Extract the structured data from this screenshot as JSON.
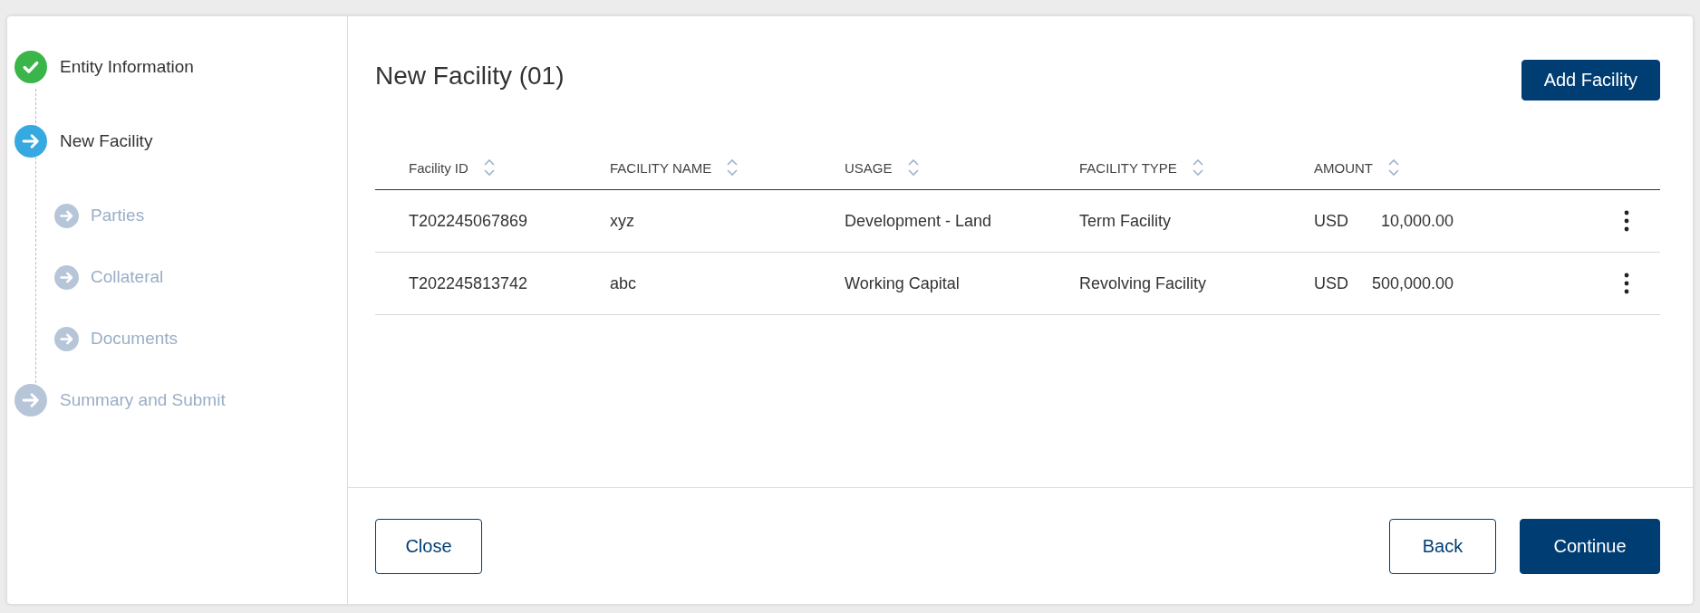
{
  "steps": [
    {
      "label": "Entity Information",
      "completed": true,
      "selected": false
    },
    {
      "label": "New Facility",
      "completed": false,
      "selected": true,
      "children": [
        {
          "label": "Parties",
          "completed": false,
          "selected": false
        },
        {
          "label": "Collateral",
          "completed": false,
          "selected": false
        },
        {
          "label": "Documents",
          "completed": false,
          "selected": false
        }
      ]
    },
    {
      "label": "Summary and Submit",
      "completed": false,
      "selected": false
    }
  ],
  "page": {
    "title": "New Facility (01)",
    "add_button": "Add Facility"
  },
  "table": {
    "columns": [
      "Facility ID",
      "FACILITY NAME",
      "USAGE",
      "FACILITY TYPE",
      "AMOUNT"
    ],
    "rows": [
      {
        "facility_id": "T202245067869",
        "facility_name": "xyz",
        "usage": "Development - Land",
        "facility_type": "Term Facility",
        "currency": "USD",
        "amount": "10,000.00"
      },
      {
        "facility_id": "T202245813742",
        "facility_name": "abc",
        "usage": "Working Capital",
        "facility_type": "Revolving Facility",
        "currency": "USD",
        "amount": "500,000.00"
      }
    ]
  },
  "footer": {
    "close": "Close",
    "back": "Back",
    "continue": "Continue"
  }
}
